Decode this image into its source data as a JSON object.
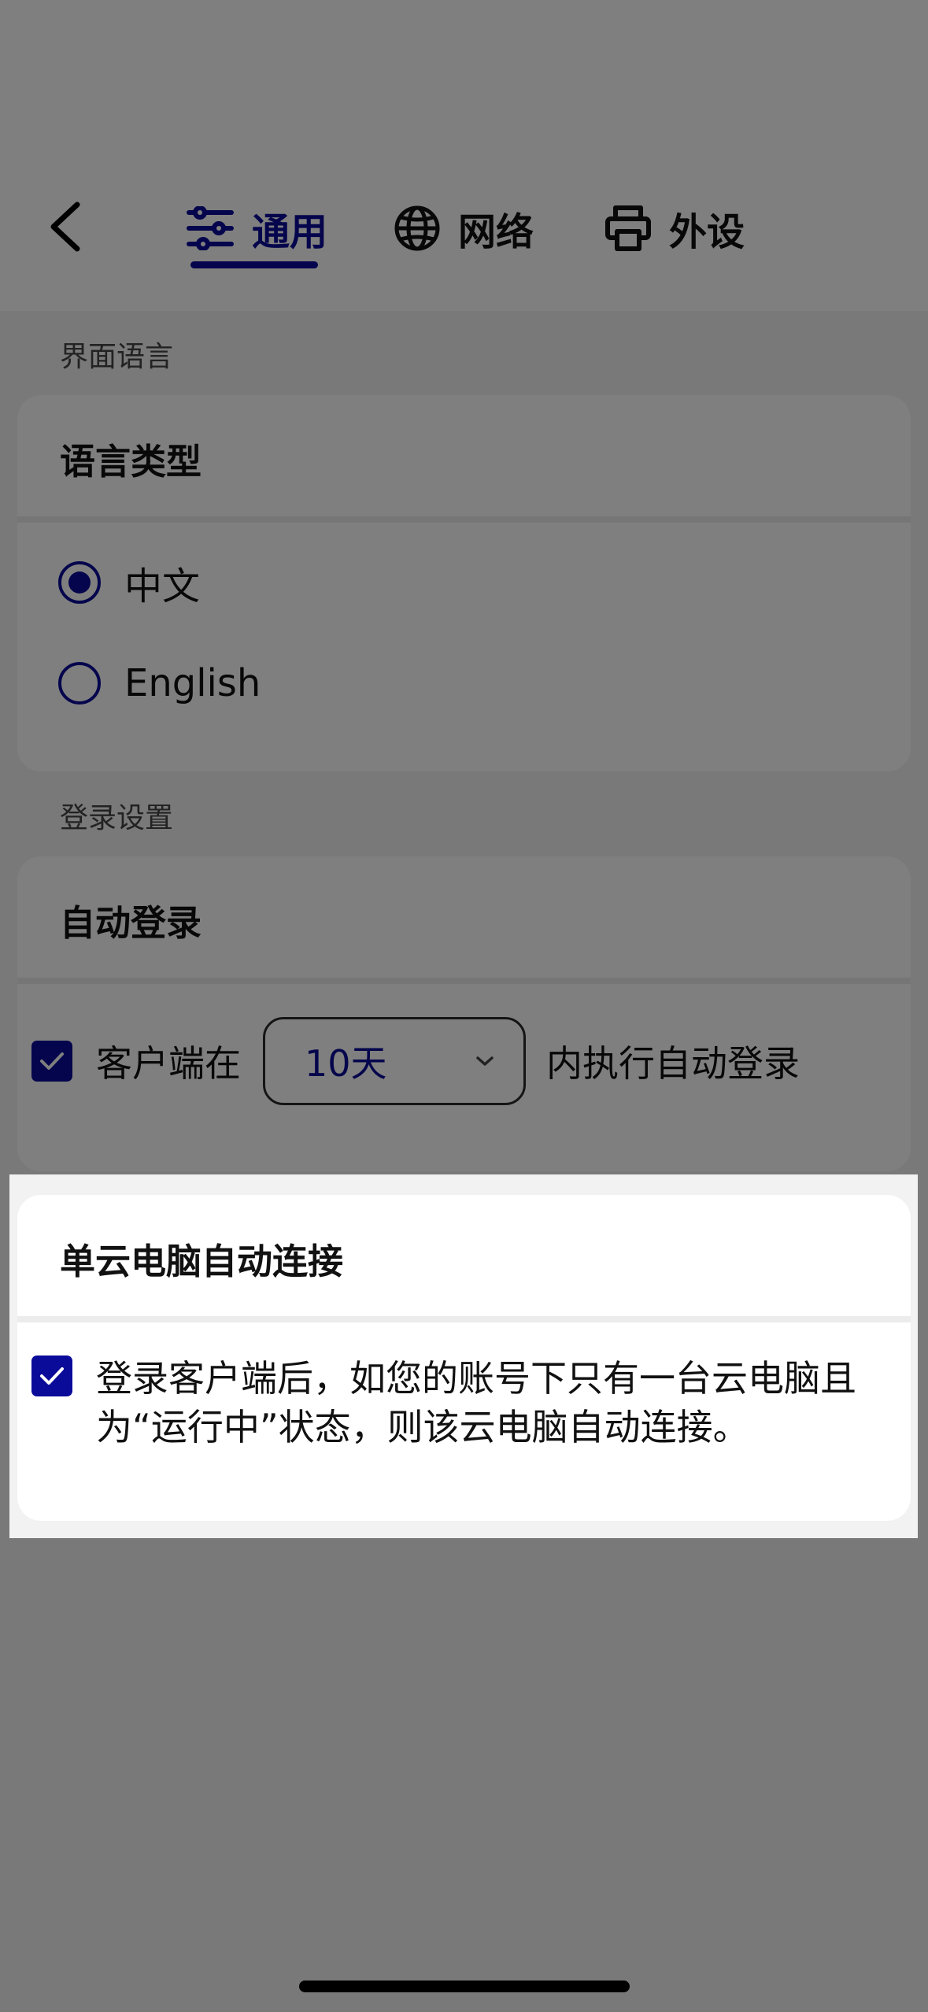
{
  "header": {
    "tabs": [
      {
        "label": "通用",
        "icon": "sliders-icon",
        "active": true
      },
      {
        "label": "网络",
        "icon": "globe-icon",
        "active": false
      },
      {
        "label": "外设",
        "icon": "printer-icon",
        "active": false
      }
    ]
  },
  "language_section": {
    "label": "界面语言",
    "card_title": "语言类型",
    "options": [
      {
        "label": "中文",
        "selected": true
      },
      {
        "label": "English",
        "selected": false
      }
    ]
  },
  "login_section": {
    "label": "登录设置",
    "card_title": "自动登录",
    "checked": true,
    "prefix": "客户端在",
    "select_value": "10天",
    "suffix": "内执行自动登录"
  },
  "connect_section": {
    "card_title": "单云电脑自动连接",
    "checked": true,
    "description": "登录客户端后，如您的账号下只有一台云电脑且为“运行中”状态，则该云电脑自动连接。"
  },
  "colors": {
    "accent": "#0b0b9a",
    "card": "#ffffff",
    "page": "#f2f2f2"
  }
}
